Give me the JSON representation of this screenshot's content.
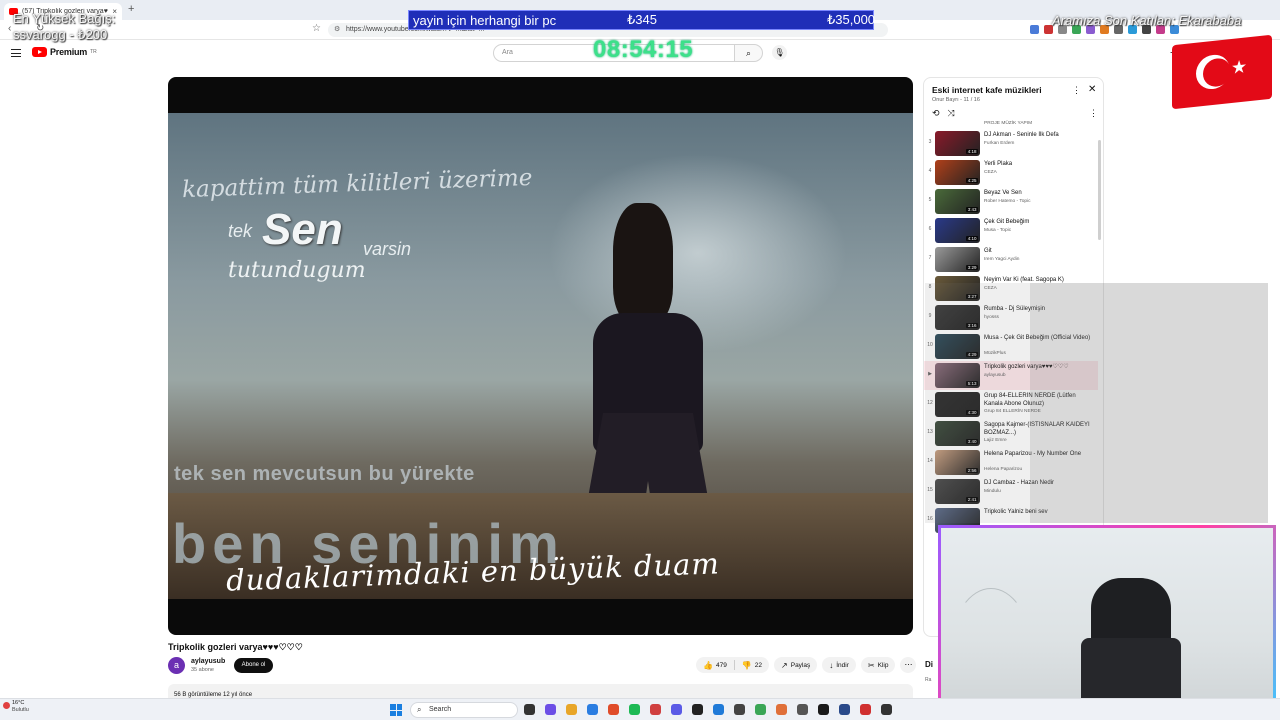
{
  "browser": {
    "tab_title": "(57) Tripkolik gozleri varya♥♥♥",
    "tab_close": "×",
    "new_tab": "+",
    "url": "https://www.youtube.com/watch?v=...&list=...",
    "nav_back": "‹",
    "nav_reload": "↻",
    "bookmark": "☆",
    "ext_colors": [
      "#4a7bd8",
      "#cc3333",
      "#888888",
      "#3aa657",
      "#8a5cd0",
      "#e07a20",
      "#666666",
      "#2a9ad8",
      "#444444",
      "#c43b8a",
      "#3b8bd8"
    ]
  },
  "youtube": {
    "logo_text": "Premium",
    "logo_sup": "TR",
    "search_placeholder": "Ara",
    "search_icon": "⌕",
    "mic_icon": "🎙",
    "create_icon": "+"
  },
  "overlays": {
    "donate_text": "yayin için herhangi bir pc",
    "donate_amount": "₺345",
    "donate_goal": "₺35,000",
    "clock": "08:54:15",
    "top_donor_label": "En Yüksek Bağış:",
    "top_donor_value": "ssvarogg - ₺200",
    "last_joined": "Aramıza Son Katılan: Ekarababa"
  },
  "video": {
    "lyric_1": "kapattim tüm kilitleri üzerime",
    "lyric_2a": "tek",
    "lyric_2b": "Sen",
    "lyric_2c": "varsin",
    "lyric_3": "tutundugum",
    "lyric_4": "tek sen mevcutsun bu yürekte",
    "lyric_5": "ben seninim",
    "lyric_6": "dudaklarimdaki en büyük duam",
    "title": "Tripkolik gozleri varya♥♥♥♡♡♡",
    "channel_initial": "a",
    "channel_name": "aylayusub",
    "channel_subs": "35 abone",
    "subscribe": "Abone ol",
    "likes": "479",
    "dislikes": "22",
    "share": "Paylaş",
    "download": "İndir",
    "clip": "Klip",
    "more": "⋯",
    "desc_preview": "56 B görüntüleme  12 yıl önce"
  },
  "playlist": {
    "title": "Eski internet kafe müzikleri",
    "subtitle": "Onur Bayrı - 11 / 16",
    "menu": "⋮",
    "close": "✕",
    "loop": "⟲",
    "shuffle": "⤨",
    "partial_channel": "PROJE MÜZİK YAPIM",
    "items": [
      {
        "idx": "3",
        "name": "DJ Akman - Seninle İlk Defa",
        "channel": "Furkan Erdem",
        "dur": "4:18",
        "color": "#8a1a2a",
        "active": false,
        "wrap": false
      },
      {
        "idx": "4",
        "name": "Yerli Plaka",
        "channel": "CEZA",
        "dur": "4:25",
        "color": "#b0401a",
        "active": false,
        "wrap": false
      },
      {
        "idx": "5",
        "name": "Beyaz Ve Sen",
        "channel": "Rober Hatemo - Topic",
        "dur": "3:43",
        "color": "#4a6a3a",
        "active": false,
        "wrap": false
      },
      {
        "idx": "6",
        "name": "Çek Git Bebeğim",
        "channel": "Musa - Topic",
        "dur": "4:10",
        "color": "#2a3a8a",
        "active": false,
        "wrap": false
      },
      {
        "idx": "7",
        "name": "Git",
        "channel": "Irem Yagci Aydin",
        "dur": "3:29",
        "color": "#9a9a9a",
        "active": false,
        "wrap": false
      },
      {
        "idx": "8",
        "name": "Neyim Var Ki (feat. Sagopa K)",
        "channel": "CEZA",
        "dur": "3:27",
        "color": "#6a5a3a",
        "active": false,
        "wrap": false
      },
      {
        "idx": "9",
        "name": "Rumba - Dj Süleymişin",
        "channel": "hyosss",
        "dur": "3:16",
        "color": "#3a3a3a",
        "active": false,
        "wrap": false
      },
      {
        "idx": "10",
        "name": "Musa - Çek Git Bebeğim (Official Video)",
        "channel": "MüzikPlus",
        "dur": "4:29",
        "color": "#2a4a5a",
        "active": false,
        "wrap": true
      },
      {
        "idx": "▶",
        "name": "Tripkolik gozleri varya♥♥♥♡♡♡",
        "channel": "aylayusub",
        "dur": "5:13",
        "color": "#8a6a7a",
        "active": true,
        "wrap": false
      },
      {
        "idx": "12",
        "name": "Grup 84-ELLERİN NERDE (Lütfen Kanala Abone Olunuz)",
        "channel": "Grup 84 ELLERİN NERDE",
        "dur": "4:30",
        "color": "#2a2a2a",
        "active": false,
        "wrap": true
      },
      {
        "idx": "13",
        "name": "Sagopa Kajmer-(ISTISNALAR KAIDEYI BOZMAZ...)",
        "channel": "Lajiz Emre",
        "dur": "3:40",
        "color": "#3a4a3a",
        "active": false,
        "wrap": true
      },
      {
        "idx": "14",
        "name": "Helena Paparizou - My Number One",
        "channel": "Helena Paparizou",
        "dur": "2:56",
        "color": "#caa080",
        "active": false,
        "wrap": true
      },
      {
        "idx": "15",
        "name": "DJ Cambaz - Hazan Nedir",
        "channel": "Mindulu",
        "dur": "2:41",
        "color": "#4a4a4a",
        "active": false,
        "wrap": false
      },
      {
        "idx": "16",
        "name": "Tripkolic Yalniz beni sev",
        "channel": "",
        "dur": "",
        "color": "#5a6a8a",
        "active": false,
        "wrap": false
      }
    ]
  },
  "side": {
    "cut_title": "Di",
    "cut_sub": "Ra"
  },
  "taskbar": {
    "weather_temp": "16°C",
    "weather_desc": "Bulutlu",
    "search": "Search",
    "search_icon": "⌕",
    "app_colors": [
      "#333333",
      "#6b4ee6",
      "#e8a62a",
      "#2a7de1",
      "#e04c2a",
      "#1db954",
      "#d04040",
      "#5a5ae6",
      "#222222",
      "#1f7ad8",
      "#444444",
      "#3aa657",
      "#e0703a",
      "#555555",
      "#1a1a1a",
      "#2a4a8a",
      "#d03030",
      "#333333"
    ]
  }
}
